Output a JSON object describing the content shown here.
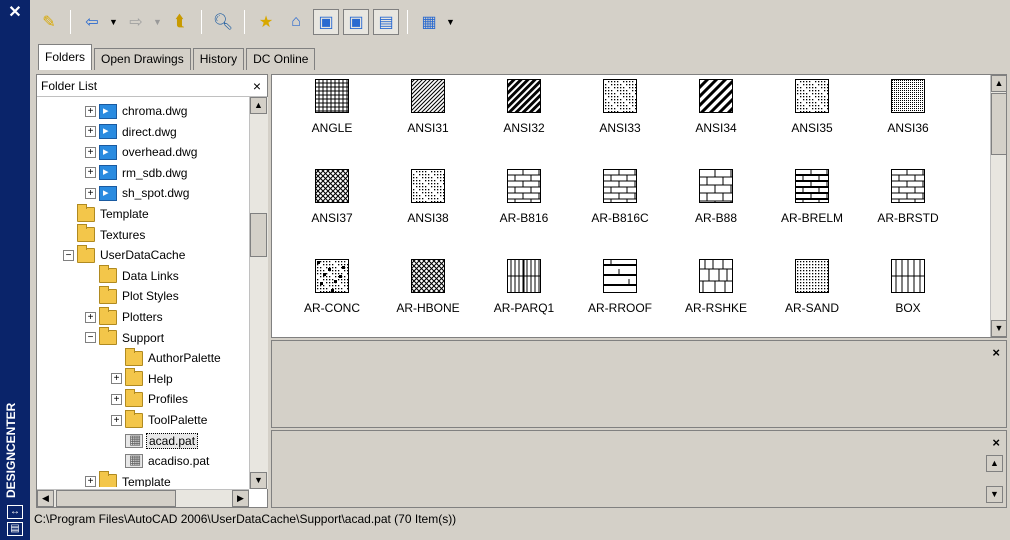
{
  "window": {
    "title": "DESIGNCENTER"
  },
  "toolbar": {
    "icons": [
      "load-icon",
      "back-icon",
      "forward-icon",
      "up-icon",
      "search-icon",
      "favorites-icon",
      "home-icon",
      "tree-view-toggle-icon",
      "preview-icon",
      "description-icon",
      "views-icon"
    ]
  },
  "tabs": [
    {
      "label": "Folders",
      "active": true
    },
    {
      "label": "Open Drawings",
      "active": false
    },
    {
      "label": "History",
      "active": false
    },
    {
      "label": "DC Online",
      "active": false
    }
  ],
  "folder_list": {
    "header": "Folder List",
    "close": "×",
    "nodes": [
      {
        "label": "chroma.dwg",
        "type": "dwg",
        "expander": "+",
        "indent": 1
      },
      {
        "label": "direct.dwg",
        "type": "dwg",
        "expander": "+",
        "indent": 1
      },
      {
        "label": "overhead.dwg",
        "type": "dwg",
        "expander": "+",
        "indent": 1
      },
      {
        "label": "rm_sdb.dwg",
        "type": "dwg",
        "expander": "+",
        "indent": 1
      },
      {
        "label": "sh_spot.dwg",
        "type": "dwg",
        "expander": "+",
        "indent": 1
      },
      {
        "label": "Template",
        "type": "folder",
        "expander": "",
        "indent": 0
      },
      {
        "label": "Textures",
        "type": "folder",
        "expander": "",
        "indent": 0
      },
      {
        "label": "UserDataCache",
        "type": "folder",
        "expander": "−",
        "indent": 0
      },
      {
        "label": "Data Links",
        "type": "folder",
        "expander": "",
        "indent": 1
      },
      {
        "label": "Plot Styles",
        "type": "folder",
        "expander": "",
        "indent": 1
      },
      {
        "label": "Plotters",
        "type": "folder",
        "expander": "+",
        "indent": 1
      },
      {
        "label": "Support",
        "type": "folder",
        "expander": "−",
        "indent": 1
      },
      {
        "label": "AuthorPalette",
        "type": "folder",
        "expander": "",
        "indent": 2
      },
      {
        "label": "Help",
        "type": "folder",
        "expander": "+",
        "indent": 2
      },
      {
        "label": "Profiles",
        "type": "folder",
        "expander": "+",
        "indent": 2
      },
      {
        "label": "ToolPalette",
        "type": "folder",
        "expander": "+",
        "indent": 2
      },
      {
        "label": "acad.pat",
        "type": "pat",
        "expander": "",
        "indent": 2,
        "selected": true
      },
      {
        "label": "acadiso.pat",
        "type": "pat",
        "expander": "",
        "indent": 2
      },
      {
        "label": "Template",
        "type": "folder",
        "expander": "+",
        "indent": 1
      }
    ]
  },
  "patterns": [
    {
      "label": "ANGLE",
      "style": "grid"
    },
    {
      "label": "ANSI31",
      "style": "diag"
    },
    {
      "label": "ANSI32",
      "style": "diag2"
    },
    {
      "label": "ANSI33",
      "style": "dots"
    },
    {
      "label": "ANSI34",
      "style": "diagwide"
    },
    {
      "label": "ANSI35",
      "style": "dots"
    },
    {
      "label": "ANSI36",
      "style": "dense"
    },
    {
      "label": "ANSI37",
      "style": "cross"
    },
    {
      "label": "ANSI38",
      "style": "dots"
    },
    {
      "label": "AR-B816",
      "style": "brick"
    },
    {
      "label": "AR-B816C",
      "style": "brick2"
    },
    {
      "label": "AR-B88",
      "style": "brick3"
    },
    {
      "label": "AR-BRELM",
      "style": "brick4"
    },
    {
      "label": "AR-BRSTD",
      "style": "brick2"
    },
    {
      "label": "AR-CONC",
      "style": "conc"
    },
    {
      "label": "AR-HBONE",
      "style": "cross"
    },
    {
      "label": "AR-PARQ1",
      "style": "parq"
    },
    {
      "label": "AR-RROOF",
      "style": "roof"
    },
    {
      "label": "AR-RSHKE",
      "style": "shake"
    },
    {
      "label": "AR-SAND",
      "style": "sand"
    },
    {
      "label": "BOX",
      "style": "box"
    }
  ],
  "panes": {
    "close": "×"
  },
  "status": {
    "path": "C:\\Program Files\\AutoCAD 2006\\UserDataCache\\Support\\acad.pat (70 Item(s))"
  }
}
